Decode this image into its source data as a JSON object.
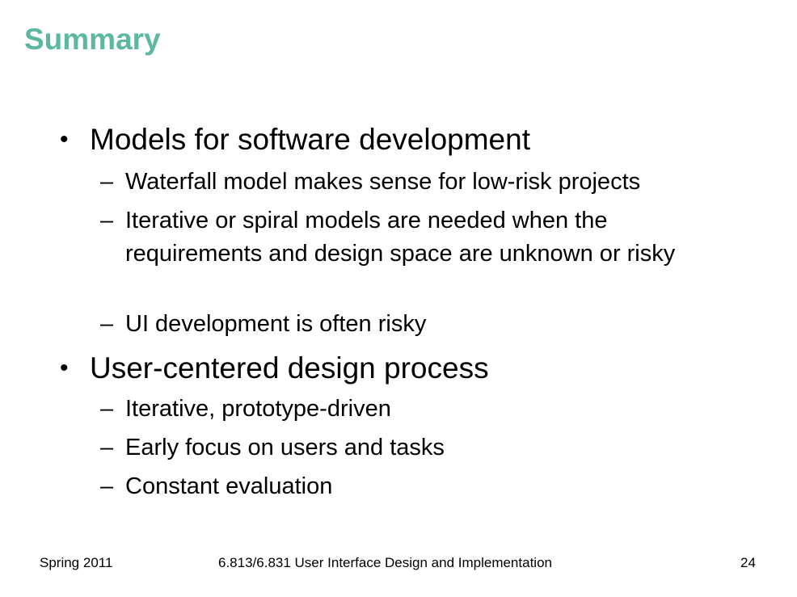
{
  "slide": {
    "title": "Summary",
    "bullets": [
      {
        "text": "Models for software development",
        "sub": [
          "Waterfall model makes sense for low-risk projects",
          "Iterative or spiral models are needed when the requirements and design space are unknown or risky",
          "UI development is often risky"
        ]
      },
      {
        "text": "User-centered design process",
        "sub": [
          "Iterative, prototype-driven",
          "Early focus on users and tasks",
          "Constant evaluation"
        ]
      }
    ],
    "bullet_mark": "•",
    "sub_mark": "–",
    "title_color": "#5cb8a0"
  },
  "footer": {
    "left": "Spring 2011",
    "center": "6.813/6.831 User Interface Design and Implementation",
    "page_number": "24"
  }
}
